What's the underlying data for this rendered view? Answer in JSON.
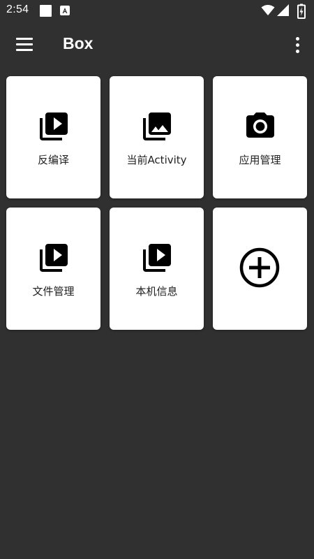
{
  "status_bar": {
    "time": "2:54",
    "icons": [
      "notification-square-icon",
      "a-notification-icon",
      "wifi-icon",
      "signal-icon",
      "battery-charging-icon"
    ]
  },
  "app_bar": {
    "menu_icon": "menu-icon",
    "title": "Box",
    "more_icon": "more-vert-icon"
  },
  "tiles": [
    {
      "label": "反编译",
      "icon": "video-library-icon"
    },
    {
      "label": "当前Activity",
      "icon": "photo-library-icon"
    },
    {
      "label": "应用管理",
      "icon": "camera-icon"
    },
    {
      "label": "文件管理",
      "icon": "video-library-icon"
    },
    {
      "label": "本机信息",
      "icon": "video-library-icon"
    },
    {
      "label": "",
      "icon": "add-circle-icon"
    }
  ],
  "colors": {
    "background": "#303030",
    "card": "#ffffff",
    "icon": "#000000",
    "text": "#222222"
  }
}
